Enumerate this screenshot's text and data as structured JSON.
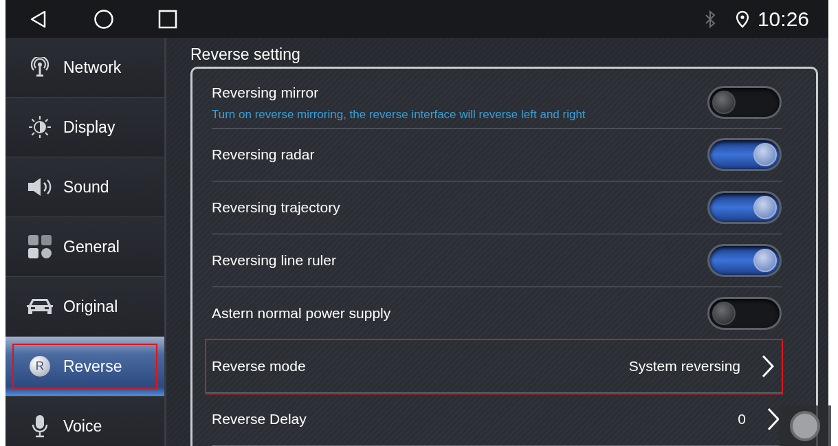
{
  "status_bar": {
    "time": "10:26"
  },
  "sidebar": {
    "items": [
      {
        "label": "Network",
        "selected": false,
        "highlighted": false
      },
      {
        "label": "Display",
        "selected": false,
        "highlighted": false
      },
      {
        "label": "Sound",
        "selected": false,
        "highlighted": false
      },
      {
        "label": "General",
        "selected": false,
        "highlighted": false
      },
      {
        "label": "Original",
        "selected": false,
        "highlighted": false
      },
      {
        "label": "Reverse",
        "badge": "R",
        "selected": true,
        "highlighted": true
      },
      {
        "label": "Voice",
        "selected": false,
        "highlighted": false
      }
    ]
  },
  "section_title": "Reverse setting",
  "settings": [
    {
      "kind": "toggle",
      "label": "Reversing mirror",
      "description": "Turn on reverse mirroring, the reverse interface will reverse left and right",
      "on": false,
      "highlighted": false
    },
    {
      "kind": "toggle",
      "label": "Reversing radar",
      "on": true,
      "highlighted": false
    },
    {
      "kind": "toggle",
      "label": "Reversing trajectory",
      "on": true,
      "highlighted": false
    },
    {
      "kind": "toggle",
      "label": "Reversing line ruler",
      "on": true,
      "highlighted": false
    },
    {
      "kind": "toggle",
      "label": "Astern normal power supply",
      "on": false,
      "highlighted": false
    },
    {
      "kind": "link",
      "label": "Reverse mode",
      "value": "System reversing",
      "highlighted": true
    },
    {
      "kind": "link",
      "label": "Reverse Delay",
      "value": "0",
      "highlighted": false
    }
  ]
}
